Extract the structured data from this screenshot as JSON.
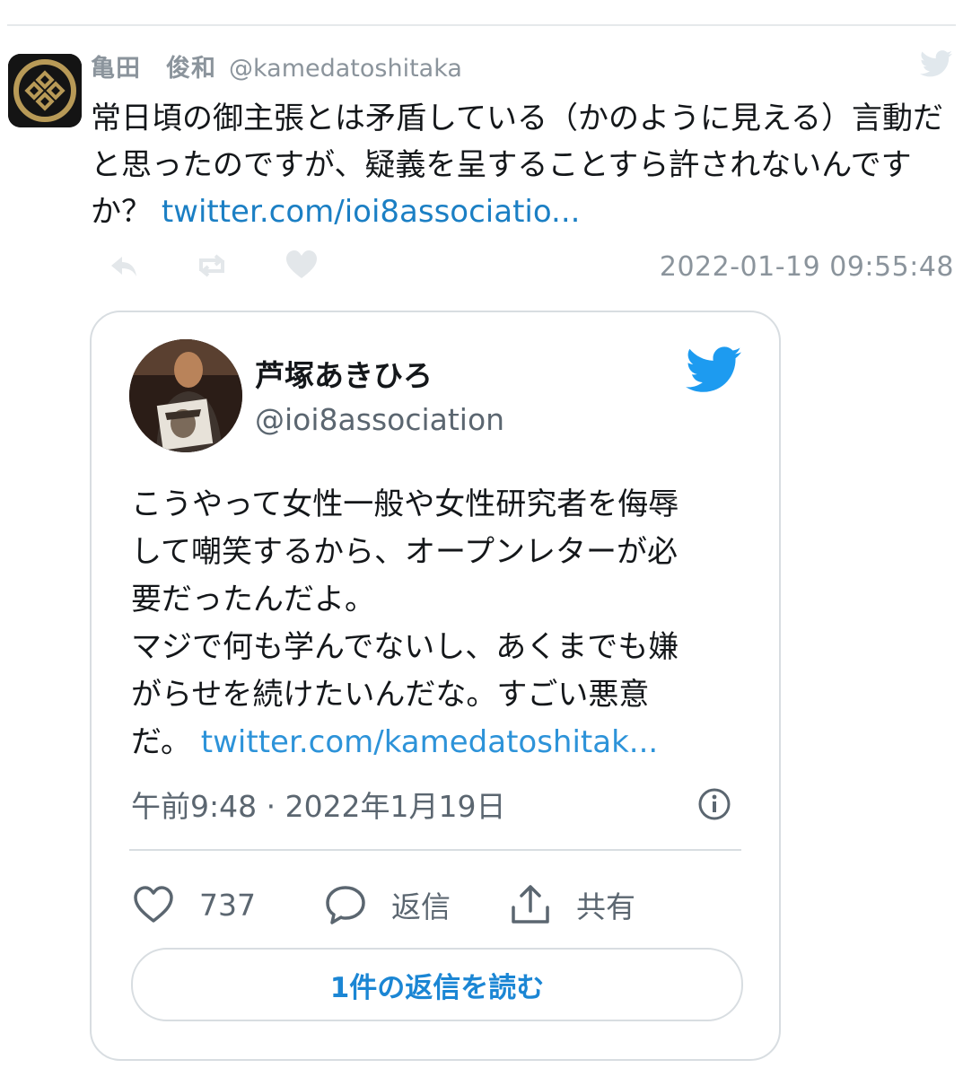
{
  "tweet": {
    "display_name": "亀田　俊和",
    "handle": "@kamedatoshitaka",
    "text": "常日頃の御主張とは矛盾している（かのように見える）言動だと思ったのですが、疑義を呈することすら許されないんですか？ ",
    "link": "twitter.com/ioi8associatio...",
    "timestamp": "2022-01-19 09:55:48",
    "icons": [
      "twitter-bird-icon",
      "reply-icon",
      "retweet-icon",
      "like-icon"
    ]
  },
  "embedded": {
    "name": "芦塚あきひろ",
    "handle": "@ioi8association",
    "lines": [
      "こうやって女性一般や女性研究者を侮辱",
      "して嘲笑するから、オープンレターが必",
      "要だったんだよ。",
      "マジで何も学んでないし、あくまでも嫌",
      "がらせを続けたいんだな。すごい悪意"
    ],
    "last_line_prefix": "だ。 ",
    "link": "twitter.com/kamedatoshitak...",
    "time": "午前9:48 · 2022年1月19日",
    "likes": "737",
    "reply_label": "返信",
    "share_label": "共有",
    "read_replies_label": "1件の返信を読む",
    "accent_color": "#1d9bf0"
  }
}
